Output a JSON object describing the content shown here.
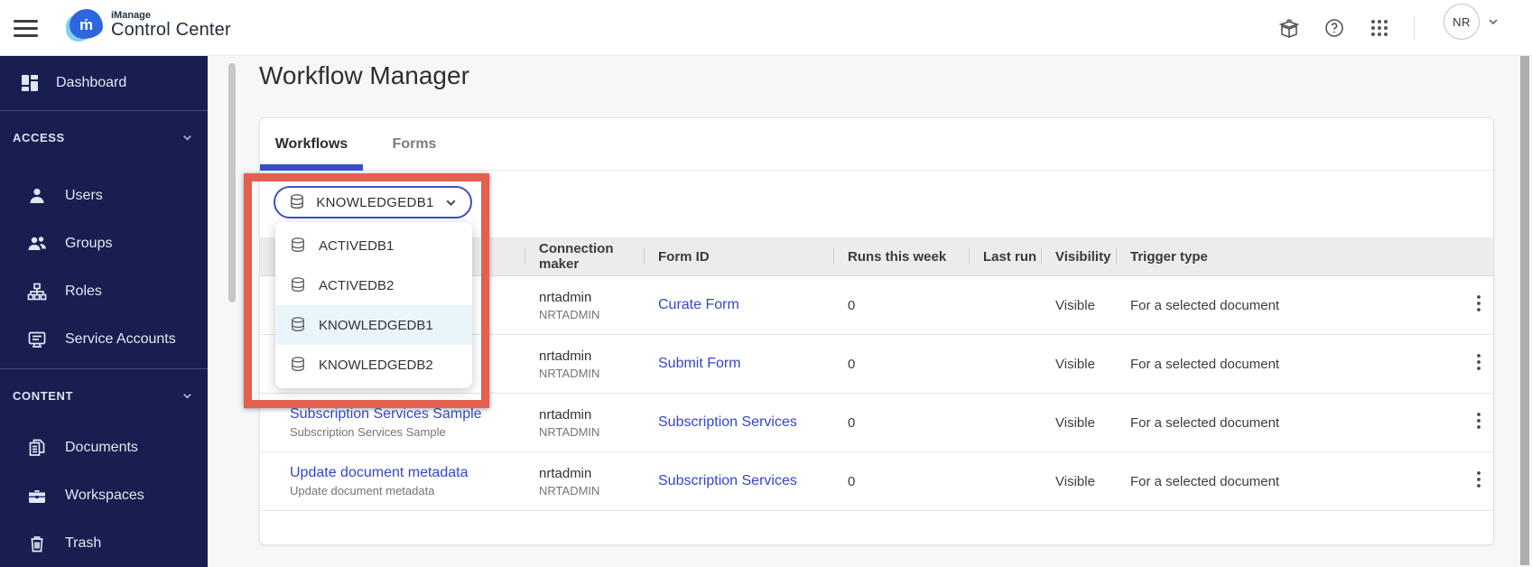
{
  "topbar": {
    "brand_small": "iManage",
    "brand_large": "Control Center",
    "user_initials": "NR",
    "icons": [
      "hamburger-menu-icon",
      "whats-new-gift-icon",
      "help-icon",
      "apps-grid-icon",
      "chevron-down-icon"
    ]
  },
  "sidebar": {
    "dashboard_label": "Dashboard",
    "sections": [
      {
        "label": "ACCESS",
        "items": [
          {
            "label": "Users",
            "icon": "user-icon"
          },
          {
            "label": "Groups",
            "icon": "groups-icon"
          },
          {
            "label": "Roles",
            "icon": "roles-hierarchy-icon"
          },
          {
            "label": "Service Accounts",
            "icon": "monitor-icon"
          }
        ]
      },
      {
        "label": "CONTENT",
        "items": [
          {
            "label": "Documents",
            "icon": "documents-icon"
          },
          {
            "label": "Workspaces",
            "icon": "briefcase-icon"
          },
          {
            "label": "Trash",
            "icon": "trash-icon"
          }
        ]
      }
    ]
  },
  "main": {
    "title": "Workflow Manager",
    "tabs": [
      {
        "label": "Workflows",
        "active": true
      },
      {
        "label": "Forms",
        "active": false
      }
    ],
    "database_dropdown": {
      "selected": "KNOWLEDGEDB1",
      "options": [
        "ACTIVEDB1",
        "ACTIVEDB2",
        "KNOWLEDGEDB1",
        "KNOWLEDGEDB2"
      ],
      "highlighted_option": "KNOWLEDGEDB1",
      "icon": "database-icon"
    },
    "table": {
      "columns": [
        "Connection maker",
        "Form ID",
        "Runs this week",
        "Last run",
        "Visibility",
        "Trigger type"
      ],
      "rows": [
        {
          "name": "",
          "subtitle": "",
          "connection_maker": "nrtadmin",
          "connection_maker_sub": "NRTADMIN",
          "form_id": "Curate Form",
          "runs_this_week": "0",
          "last_run": "",
          "visibility": "Visible",
          "trigger_type": "For a selected document"
        },
        {
          "name": "",
          "subtitle": "",
          "connection_maker": "nrtadmin",
          "connection_maker_sub": "NRTADMIN",
          "form_id": "Submit Form",
          "runs_this_week": "0",
          "last_run": "",
          "visibility": "Visible",
          "trigger_type": "For a selected document"
        },
        {
          "name": "Subscription Services Sample",
          "subtitle": "Subscription Services Sample",
          "connection_maker": "nrtadmin",
          "connection_maker_sub": "NRTADMIN",
          "form_id": "Subscription Services",
          "runs_this_week": "0",
          "last_run": "",
          "visibility": "Visible",
          "trigger_type": "For a selected document"
        },
        {
          "name": "Update document metadata",
          "subtitle": "Update document metadata",
          "connection_maker": "nrtadmin",
          "connection_maker_sub": "NRTADMIN",
          "form_id": "Subscription Services",
          "runs_this_week": "0",
          "last_run": "",
          "visibility": "Visible",
          "trigger_type": "For a selected document"
        }
      ]
    }
  },
  "colors": {
    "sidebar_navy": "#181e4f",
    "accent_indigo": "#3b4cc8",
    "link_blue": "#3447c5",
    "dropdown_highlight": "#e9f5fb",
    "annotation_red": "#e2604e",
    "header_gray": "#ececec"
  }
}
